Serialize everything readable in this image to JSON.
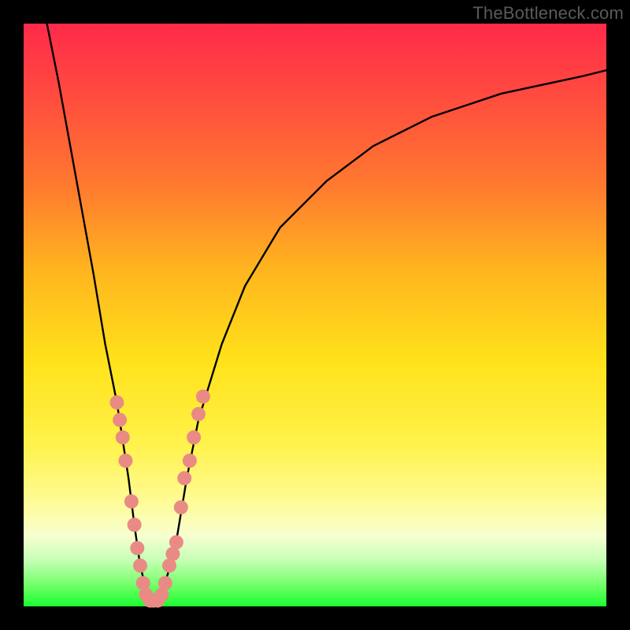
{
  "watermark": "TheBottleneck.com",
  "chart_data": {
    "type": "line",
    "title": "",
    "xlabel": "",
    "ylabel": "",
    "xlim": [
      0,
      100
    ],
    "ylim": [
      0,
      100
    ],
    "grid": false,
    "legend": false,
    "series": [
      {
        "name": "bottleneck-curve",
        "x": [
          4,
          6,
          8,
          10,
          12,
          14,
          16,
          18,
          19,
          20,
          21,
          22,
          23,
          24,
          26,
          28,
          30,
          34,
          38,
          44,
          52,
          60,
          70,
          82,
          96,
          100
        ],
        "values": [
          100,
          90,
          79,
          68,
          57,
          45,
          35,
          22,
          14,
          7,
          3,
          1,
          1,
          3,
          10,
          22,
          32,
          45,
          55,
          65,
          73,
          79,
          84,
          88,
          91,
          92
        ]
      }
    ],
    "markers": {
      "name": "salmon-dots",
      "color": "#e98b84",
      "points": [
        {
          "x": 16.0,
          "y": 35
        },
        {
          "x": 16.5,
          "y": 32
        },
        {
          "x": 17.0,
          "y": 29
        },
        {
          "x": 17.5,
          "y": 25
        },
        {
          "x": 18.5,
          "y": 18
        },
        {
          "x": 19.0,
          "y": 14
        },
        {
          "x": 19.5,
          "y": 10
        },
        {
          "x": 20.0,
          "y": 7
        },
        {
          "x": 20.5,
          "y": 4
        },
        {
          "x": 21.0,
          "y": 2
        },
        {
          "x": 21.7,
          "y": 1
        },
        {
          "x": 22.3,
          "y": 1
        },
        {
          "x": 23.0,
          "y": 1
        },
        {
          "x": 23.7,
          "y": 2
        },
        {
          "x": 24.3,
          "y": 4
        },
        {
          "x": 25.0,
          "y": 7
        },
        {
          "x": 25.6,
          "y": 9
        },
        {
          "x": 26.2,
          "y": 11
        },
        {
          "x": 27.0,
          "y": 17
        },
        {
          "x": 27.6,
          "y": 22
        },
        {
          "x": 28.5,
          "y": 25
        },
        {
          "x": 29.2,
          "y": 29
        },
        {
          "x": 30.0,
          "y": 33
        },
        {
          "x": 30.8,
          "y": 36
        }
      ]
    },
    "gradient_stops": [
      {
        "pos": 0,
        "color": "#ff2a4a"
      },
      {
        "pos": 28,
        "color": "#ff7a2f"
      },
      {
        "pos": 58,
        "color": "#ffe21a"
      },
      {
        "pos": 88,
        "color": "#f6ffd0"
      },
      {
        "pos": 100,
        "color": "#1aff2f"
      }
    ]
  }
}
